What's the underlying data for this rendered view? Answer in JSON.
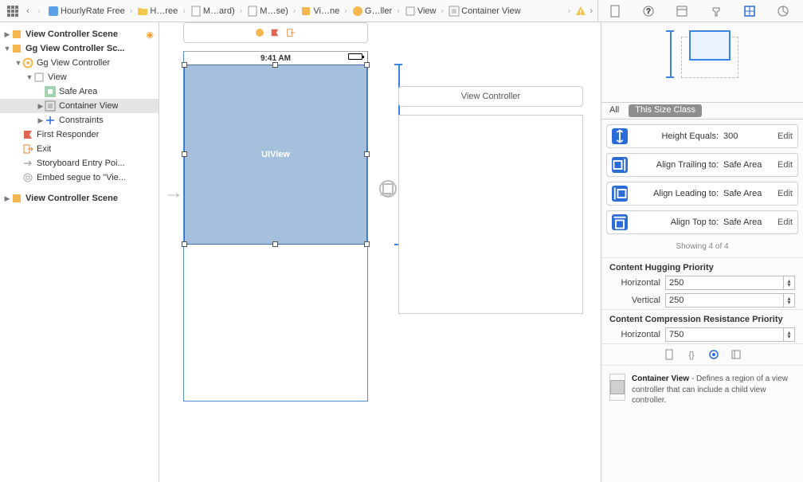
{
  "breadcrumbs": [
    {
      "label": "HourlyRate Free",
      "kind": "project"
    },
    {
      "label": "H…ree",
      "kind": "folder"
    },
    {
      "label": "M…ard)",
      "kind": "storyboard"
    },
    {
      "label": "M…se)",
      "kind": "storyboard"
    },
    {
      "label": "Vi…ne",
      "kind": "scene"
    },
    {
      "label": "G…ller",
      "kind": "vc"
    },
    {
      "label": "View",
      "kind": "view"
    },
    {
      "label": "Container View",
      "kind": "container"
    }
  ],
  "outline": {
    "scenes": [
      {
        "label": "View Controller Scene",
        "expanded": true,
        "badge": true,
        "children": []
      },
      {
        "label": "Gg View Controller Sc...",
        "expanded": true,
        "children": [
          {
            "label": "Gg View Controller",
            "kind": "vc",
            "expanded": true,
            "children": [
              {
                "label": "View",
                "kind": "view",
                "expanded": true,
                "children": [
                  {
                    "label": "Safe Area",
                    "kind": "safearea"
                  },
                  {
                    "label": "Container View",
                    "kind": "container",
                    "selected": true
                  },
                  {
                    "label": "Constraints",
                    "kind": "constraints"
                  }
                ]
              }
            ]
          },
          {
            "label": "First Responder",
            "kind": "firstresponder"
          },
          {
            "label": "Exit",
            "kind": "exit"
          },
          {
            "label": "Storyboard Entry Poi...",
            "kind": "entry"
          },
          {
            "label": "Embed segue to \"Vie...",
            "kind": "segue"
          }
        ]
      },
      {
        "label": "View Controller Scene",
        "expanded": false,
        "children": []
      }
    ]
  },
  "canvas": {
    "statusTime": "9:41 AM",
    "selectedLabel": "UIView",
    "secondSceneTitle": "View Controller"
  },
  "inspector": {
    "sizeTabs": {
      "all": "All",
      "thisClass": "This Size Class"
    },
    "constraints": [
      {
        "key": "Height Equals:",
        "value": "300",
        "edit": "Edit",
        "icon": "h"
      },
      {
        "key": "Align Trailing to:",
        "value": "Safe Area",
        "edit": "Edit",
        "icon": "t"
      },
      {
        "key": "Align Leading to:",
        "value": "Safe Area",
        "edit": "Edit",
        "icon": "l"
      },
      {
        "key": "Align Top to:",
        "value": "Safe Area",
        "edit": "Edit",
        "icon": "top"
      }
    ],
    "showing": "Showing 4 of 4",
    "hugging": {
      "title": "Content Hugging Priority",
      "horizontal": "250",
      "vertical": "250",
      "hLabel": "Horizontal",
      "vLabel": "Vertical"
    },
    "compression": {
      "title": "Content Compression Resistance Priority",
      "horizontal": "750",
      "hLabel": "Horizontal"
    },
    "help": {
      "title": "Container View",
      "body": " - Defines a region of a view controller that can include a child view controller."
    }
  }
}
